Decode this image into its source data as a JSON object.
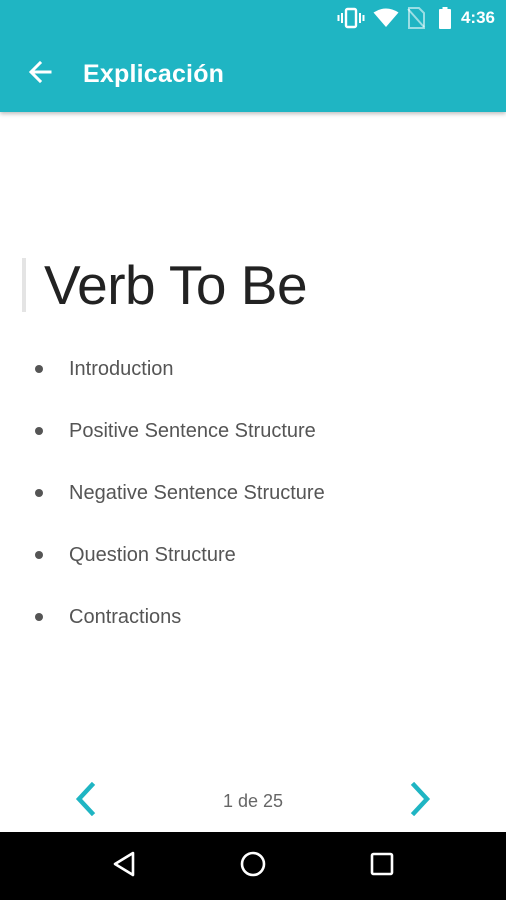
{
  "status_bar": {
    "time": "4:36",
    "icons": [
      "vibrate-icon",
      "wifi-icon",
      "no-sim-icon",
      "battery-icon"
    ]
  },
  "toolbar": {
    "title": "Explicación",
    "back_icon": "arrow-back-icon"
  },
  "lesson": {
    "title": "Verb To Be",
    "topics": [
      "Introduction",
      "Positive Sentence Structure",
      "Negative Sentence Structure",
      "Question Structure",
      "Contractions"
    ]
  },
  "pager": {
    "indicator": "1 de 25",
    "prev_icon": "chevron-left-icon",
    "next_icon": "chevron-right-icon"
  },
  "navigation_bar": {
    "buttons": [
      "nav-back-icon",
      "nav-home-icon",
      "nav-recents-icon"
    ]
  },
  "colors": {
    "app_bar": "#1fb5c3",
    "accent": "#1fb5c3",
    "title_text": "#222222",
    "topic_text": "#555555",
    "nav_bar": "#000000"
  }
}
